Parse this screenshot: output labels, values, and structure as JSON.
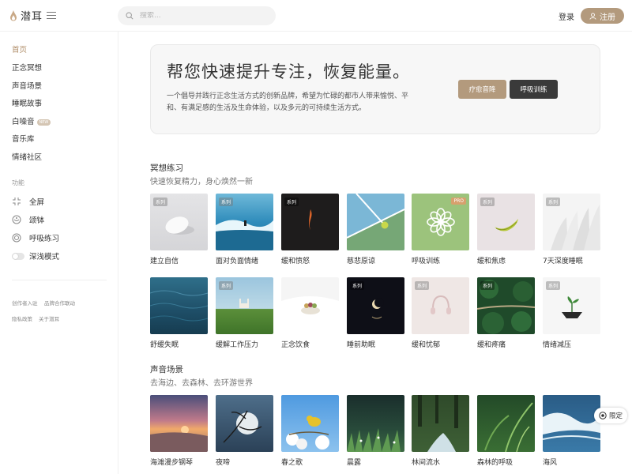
{
  "header": {
    "logo_text": "潜耳",
    "search_placeholder": "搜索...",
    "login_label": "登录",
    "register_label": "注册"
  },
  "sidebar": {
    "nav": [
      {
        "label": "首页",
        "active": true
      },
      {
        "label": "正念冥想"
      },
      {
        "label": "声音场景"
      },
      {
        "label": "睡眠故事"
      },
      {
        "label": "白噪音",
        "badge": "NEW"
      },
      {
        "label": "音乐库"
      },
      {
        "label": "情绪社区"
      }
    ],
    "functions_title": "功能",
    "functions": [
      {
        "label": "全屏",
        "icon": "fullscreen-icon"
      },
      {
        "label": "颂钵",
        "icon": "singing-bowl-icon"
      },
      {
        "label": "呼吸练习",
        "icon": "breathing-icon"
      },
      {
        "label": "深浅模式",
        "icon": "toggle-switch"
      }
    ],
    "footer_links": [
      "创作者入驻",
      "品牌合作联动",
      "隐私政策",
      "关于潜耳"
    ]
  },
  "hero": {
    "title": "帮您快速提升专注，恢复能量。",
    "description": "一个倡导并践行正念生活方式的创新品牌，希望为忙碌的都市人带来愉悦、平和、有满足感的生活及生命体验，以及多元的可持续生活方式。",
    "btn_heal": "疗愈音降",
    "btn_breath": "呼吸训练"
  },
  "meditation": {
    "title": "冥想练习",
    "subtitle": "快速恢复精力，身心焕然一新",
    "tag_label": "系列",
    "pro_label": "PRO",
    "row1": [
      {
        "title": "建立自信",
        "tag": true
      },
      {
        "title": "面对负面情绪",
        "tag": true
      },
      {
        "title": "缓和愤怒",
        "tag": true
      },
      {
        "title": "慈悲原谅",
        "tag": false
      },
      {
        "title": "呼吸训练",
        "pro": true
      },
      {
        "title": "缓和焦虑",
        "tag": true
      },
      {
        "title": "7天深度睡眠",
        "tag": true
      }
    ],
    "row2": [
      {
        "title": "舒缓失眠",
        "tag": false
      },
      {
        "title": "缓解工作压力",
        "tag": true
      },
      {
        "title": "正念饮食",
        "tag": false
      },
      {
        "title": "睡前助眠",
        "tag": true
      },
      {
        "title": "缓和忧郁",
        "tag": true
      },
      {
        "title": "缓和疼痛",
        "tag": true
      },
      {
        "title": "情绪减压",
        "tag": true
      }
    ]
  },
  "soundscape": {
    "title": "声音场景",
    "subtitle": "去海边、去森林、去环游世界",
    "items": [
      {
        "title": "海滩漫步钢琴"
      },
      {
        "title": "夜啼"
      },
      {
        "title": "春之歌"
      },
      {
        "title": "晨露"
      },
      {
        "title": "林间流水"
      },
      {
        "title": "森林的呼吸"
      },
      {
        "title": "海风"
      }
    ]
  },
  "limit_label": "限定"
}
